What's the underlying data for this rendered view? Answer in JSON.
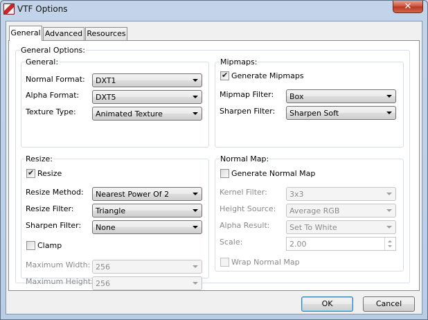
{
  "window": {
    "title": "VTF Options",
    "close_glyph": "✕",
    "icon": "vtf-app-icon"
  },
  "tabs": [
    {
      "label": "General",
      "active": true
    },
    {
      "label": "Advanced",
      "active": false
    },
    {
      "label": "Resources",
      "active": false
    }
  ],
  "general_options": {
    "title": "General Options:",
    "general": {
      "title": "General:",
      "normal_format_label": "Normal Format:",
      "normal_format_value": "DXT1",
      "alpha_format_label": "Alpha Format:",
      "alpha_format_value": "DXT5",
      "texture_type_label": "Texture Type:",
      "texture_type_value": "Animated Texture"
    },
    "mipmaps": {
      "title": "Mipmaps:",
      "generate_label": "Generate Mipmaps",
      "generate_checked": true,
      "filter_label": "Mipmap Filter:",
      "filter_value": "Box",
      "sharpen_label": "Sharpen Filter:",
      "sharpen_value": "Sharpen Soft"
    },
    "resize": {
      "title": "Resize:",
      "resize_label": "Resize",
      "resize_checked": true,
      "method_label": "Resize Method:",
      "method_value": "Nearest Power Of 2",
      "filter_label": "Resize Filter:",
      "filter_value": "Triangle",
      "sharpen_label": "Sharpen Filter:",
      "sharpen_value": "None",
      "clamp_label": "Clamp",
      "clamp_checked": false,
      "max_width_label": "Maximum Width:",
      "max_width_value": "256",
      "max_height_label": "Maximum Height:",
      "max_height_value": "256"
    },
    "normal_map": {
      "title": "Normal Map:",
      "generate_label": "Generate Normal Map",
      "generate_checked": false,
      "kernel_label": "Kernel Filter:",
      "kernel_value": "3x3",
      "height_label": "Height Source:",
      "height_value": "Average RGB",
      "alpha_label": "Alpha Result:",
      "alpha_value": "Set To White",
      "scale_label": "Scale:",
      "scale_value": "2.00",
      "wrap_label": "Wrap Normal Map",
      "wrap_checked": false
    }
  },
  "buttons": {
    "ok": "OK",
    "cancel": "Cancel"
  }
}
